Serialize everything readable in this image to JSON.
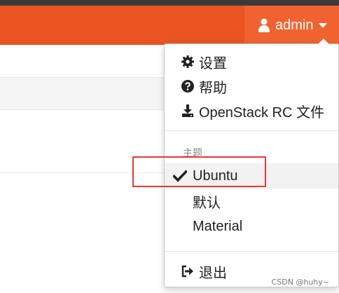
{
  "navbar": {
    "user_label": "admin",
    "brand_color": "#e95420"
  },
  "menu": {
    "settings": "设置",
    "help": "帮助",
    "openstack_rc": "OpenStack RC 文件",
    "theme_header": "主题",
    "themes": [
      "Ubuntu",
      "默认",
      "Material"
    ],
    "active_theme": "Ubuntu",
    "logout": "退出"
  },
  "icons": {
    "user": "user-icon",
    "caret": "caret-down-icon",
    "settings": "gear-icon",
    "help": "question-circle-icon",
    "download": "download-icon",
    "check": "check-icon",
    "logout": "sign-out-icon"
  },
  "annotation_color": "#e53935",
  "watermark": "CSDN @huhy~"
}
